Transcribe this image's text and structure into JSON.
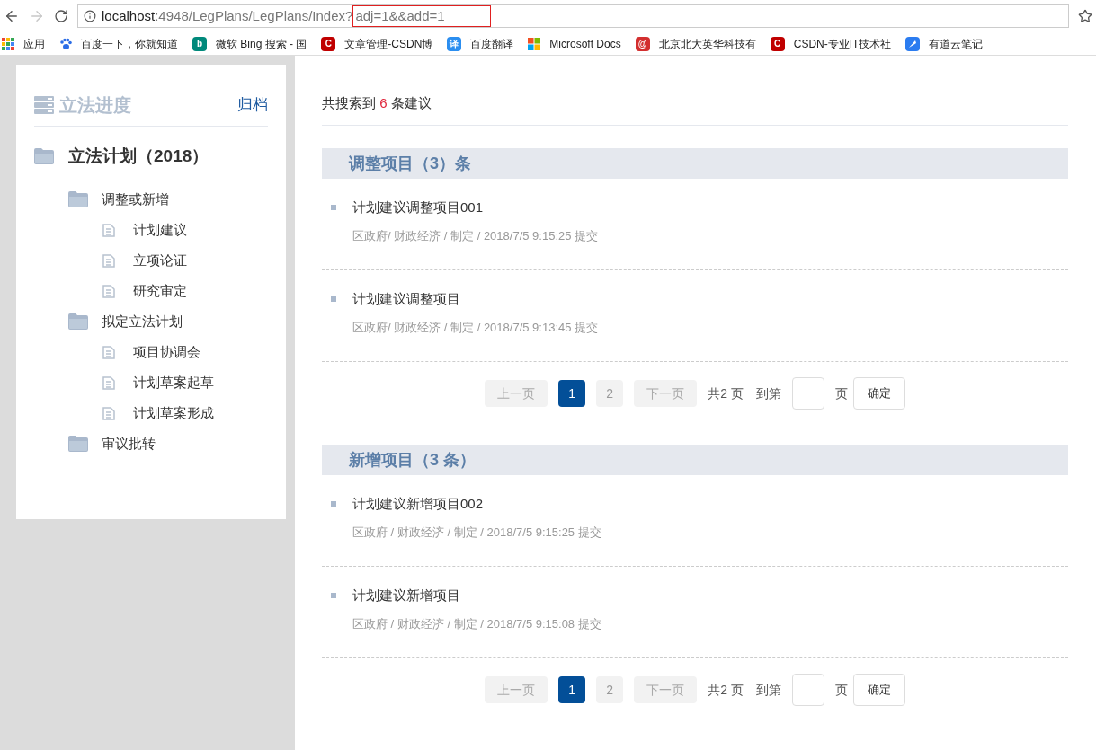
{
  "browser": {
    "back_disabled": false,
    "forward_disabled": true,
    "url": {
      "host": "localhost",
      "path": ":4948/LegPlans/LegPlans/Index?",
      "query": "adj=1&&add=1"
    }
  },
  "bookmarks": [
    {
      "kind": "grid",
      "label": "应用"
    },
    {
      "kind": "paw",
      "label": "百度一下，你就知道"
    },
    {
      "kind": "letter",
      "glyph": "b",
      "color": "#00897b",
      "label": "微软 Bing 搜索 - 国"
    },
    {
      "kind": "letter",
      "glyph": "C",
      "color": "#c00000",
      "label": "文章管理-CSDN博"
    },
    {
      "kind": "letter",
      "glyph": "译",
      "color": "#2b8ef0",
      "label": "百度翻译"
    },
    {
      "kind": "ms",
      "label": "Microsoft Docs"
    },
    {
      "kind": "letter",
      "glyph": "@",
      "color": "#d32f2f",
      "label": "北京北大英华科技有"
    },
    {
      "kind": "letter",
      "glyph": "C",
      "color": "#c00000",
      "label": "CSDN-专业IT技术社"
    },
    {
      "kind": "feather",
      "label": "有道云笔记"
    }
  ],
  "sidebar": {
    "title": "立法进度",
    "archive_link": "归档",
    "tree": [
      {
        "label": "立法计划（2018）",
        "kind": "folder",
        "children": [
          {
            "label": "调整或新增",
            "kind": "folder",
            "children": [
              {
                "label": "计划建议",
                "kind": "doc"
              },
              {
                "label": "立项论证",
                "kind": "doc"
              },
              {
                "label": "研究审定",
                "kind": "doc"
              }
            ]
          },
          {
            "label": "拟定立法计划",
            "kind": "folder",
            "children": [
              {
                "label": "项目协调会",
                "kind": "doc"
              },
              {
                "label": "计划草案起草",
                "kind": "doc"
              },
              {
                "label": "计划草案形成",
                "kind": "doc"
              }
            ]
          },
          {
            "label": "审议批转",
            "kind": "folder"
          }
        ]
      }
    ]
  },
  "summary": {
    "before": "共搜索到",
    "count": "6",
    "after": "条建议"
  },
  "sections": [
    {
      "title": "调整项目（3）条",
      "items": [
        {
          "title": "计划建议调整项目001",
          "meta": "区政府/ 财政经济 / 制定 / 2018/7/5 9:15:25 提交"
        },
        {
          "title": "计划建议调整项目",
          "meta": "区政府/ 财政经济 / 制定 / 2018/7/5 9:13:45 提交"
        }
      ],
      "pagination": {
        "prev": {
          "label": "上一页",
          "disabled": true
        },
        "pages": [
          {
            "label": "1",
            "selected": true
          },
          {
            "label": "2",
            "selected": false
          }
        ],
        "next": {
          "label": "下一页",
          "disabled": true
        },
        "total": "共2 页",
        "goto": "到第",
        "page_unit": "页",
        "confirm": "确定"
      }
    },
    {
      "title": "新增项目（3 条）",
      "items": [
        {
          "title": "计划建议新增项目002",
          "meta": "区政府 / 财政经济 / 制定 / 2018/7/5 9:15:25 提交"
        },
        {
          "title": "计划建议新增项目",
          "meta": "区政府 / 财政经济 / 制定 / 2018/7/5 9:15:08 提交"
        }
      ],
      "pagination": {
        "prev": {
          "label": "上一页",
          "disabled": true
        },
        "pages": [
          {
            "label": "1",
            "selected": true
          },
          {
            "label": "2",
            "selected": false
          }
        ],
        "next": {
          "label": "下一页",
          "disabled": true
        },
        "total": "共2 页",
        "goto": "到第",
        "page_unit": "页",
        "confirm": "确定"
      }
    }
  ]
}
